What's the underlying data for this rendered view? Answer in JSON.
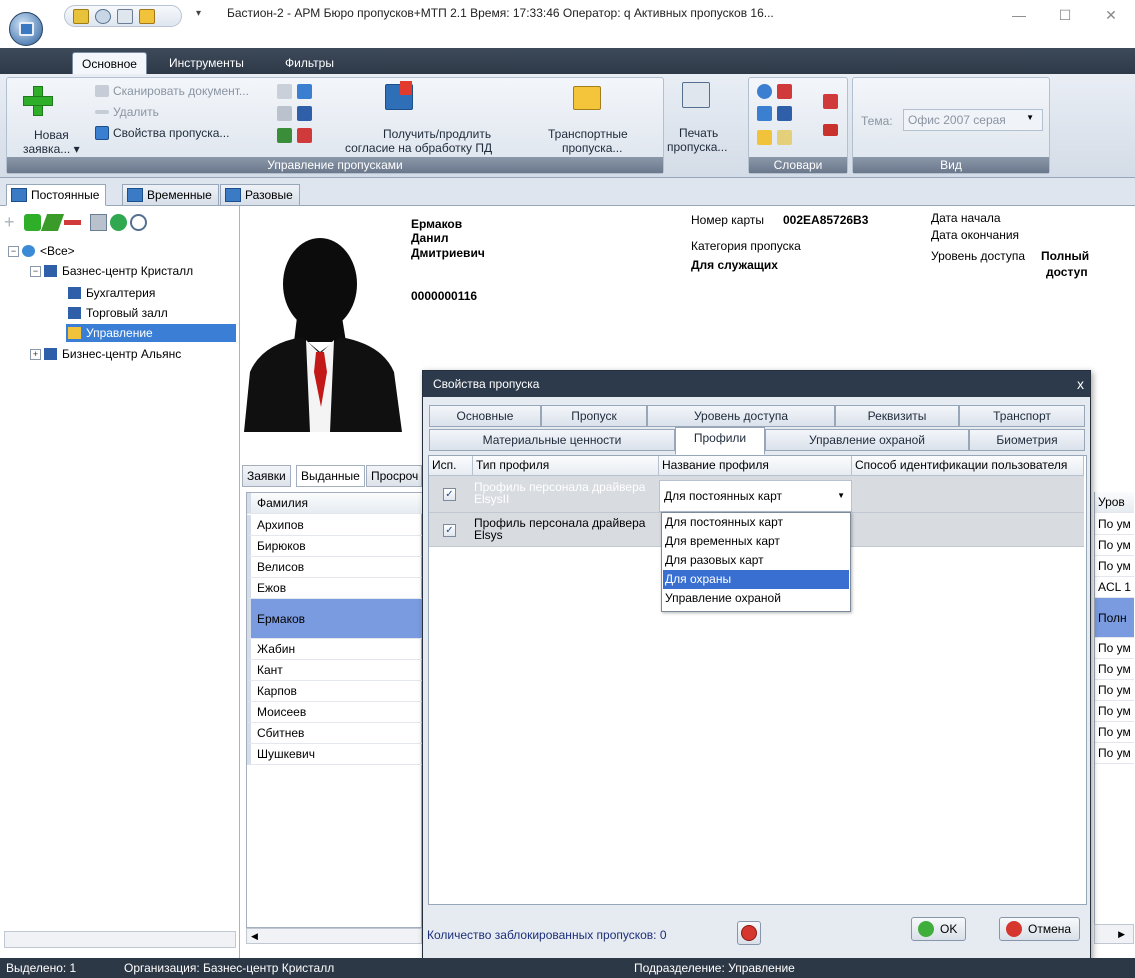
{
  "window": {
    "title": "Бастион-2 - АРМ Бюро пропусков+МТП 2.1 Время: 17:33:46 Оператор: q  Активных пропусков 16...",
    "minimize": "—",
    "maximize": "☐",
    "close": "✕"
  },
  "ribbon_tabs": [
    "Основное",
    "Инструменты",
    "Фильтры"
  ],
  "ribbon": {
    "new_request": "Новая",
    "new_request_sub": "заявка... ▾",
    "scan_document": "Сканировать документ...",
    "delete": "Удалить",
    "pass_properties": "Свойства пропуска...",
    "consent": "Получить/продлить",
    "consent_sub": "согласие на обработку ПД",
    "transport": "Транспортные",
    "transport_sub": "пропуска...",
    "print": "Печать",
    "print_sub": "пропуска...",
    "group_pass_management": "Управление пропусками",
    "group_dictionaries": "Словари",
    "theme_label": "Тема:",
    "theme_value": "Офис 2007 серая",
    "group_view": "Вид"
  },
  "doc_tabs": [
    "Постоянные",
    "Временные",
    "Разовые"
  ],
  "tree": {
    "root": "<Все>",
    "org1": "Базнес-центр Кристалл",
    "dept1": "Бухгалтерия",
    "dept2": "Торговый залл",
    "dept3": "Управление",
    "org2": "Бизнес-центр Альянс"
  },
  "person": {
    "last_name": "Ермаков",
    "first_name": "Данил",
    "patronymic": "Дмитриевич",
    "number": "0000000116",
    "card_label": "Номер карты",
    "card_value": "002EA85726B3",
    "category_label": "Категория пропуска",
    "category_value": "Для служащих",
    "start_label": "Дата начала",
    "end_label": "Дата окончания",
    "access_label": "Уровень доступа",
    "access_value_1": "Полный",
    "access_value_2": "доступ"
  },
  "sub_tabs": [
    "Заявки",
    "Выданные",
    "Просроч"
  ],
  "grid": {
    "header": "Фамилия",
    "right_header": "Уров",
    "rows": [
      "Архипов",
      "Бирюков",
      "Велисов",
      "Ежов",
      "Ермаков",
      "Жабин",
      "Кант",
      "Карпов",
      "Моисеев",
      "Сбитнев",
      "Шушкевич"
    ],
    "right_rows": [
      "По ум",
      "По ум",
      "По ум",
      "ACL 1",
      "Полн",
      "По ум",
      "По ум",
      "По ум",
      "По ум",
      "По ум",
      "По ум"
    ]
  },
  "dialog": {
    "title": "Свойства пропуска",
    "close": "x",
    "tabs_row1": [
      "Основные",
      "Пропуск",
      "Уровень доступа",
      "Реквизиты",
      "Транспорт"
    ],
    "tabs_row2": [
      "Материальные ценности",
      "Профили",
      "Управление охраной",
      "Биометрия"
    ],
    "columns": [
      "Исп.",
      "Тип профиля",
      "Название профиля",
      "Способ идентификации пользователя"
    ],
    "rows": [
      {
        "type_line1": "Профиль персонала драйвера",
        "type_line2": "ElsysII",
        "name": "Для постоянных карт",
        "checked": "✓"
      },
      {
        "type_line1": "Профиль персонала драйвера",
        "type_line2": "Elsys",
        "name": "",
        "checked": "✓"
      }
    ],
    "dropdown_options": [
      "Для постоянных карт",
      "Для временных карт",
      "Для разовых карт",
      "Для охраны",
      "Управление охраной"
    ],
    "dropdown_selected_index": 3,
    "blocked_label": "Количество заблокированных пропусков: 0",
    "ok": "OK",
    "cancel": "Отмена"
  },
  "status": {
    "selected": "Выделено: 1",
    "organization": "Организация: Базнес-центр Кристалл",
    "division": "Подразделение: Управление"
  }
}
